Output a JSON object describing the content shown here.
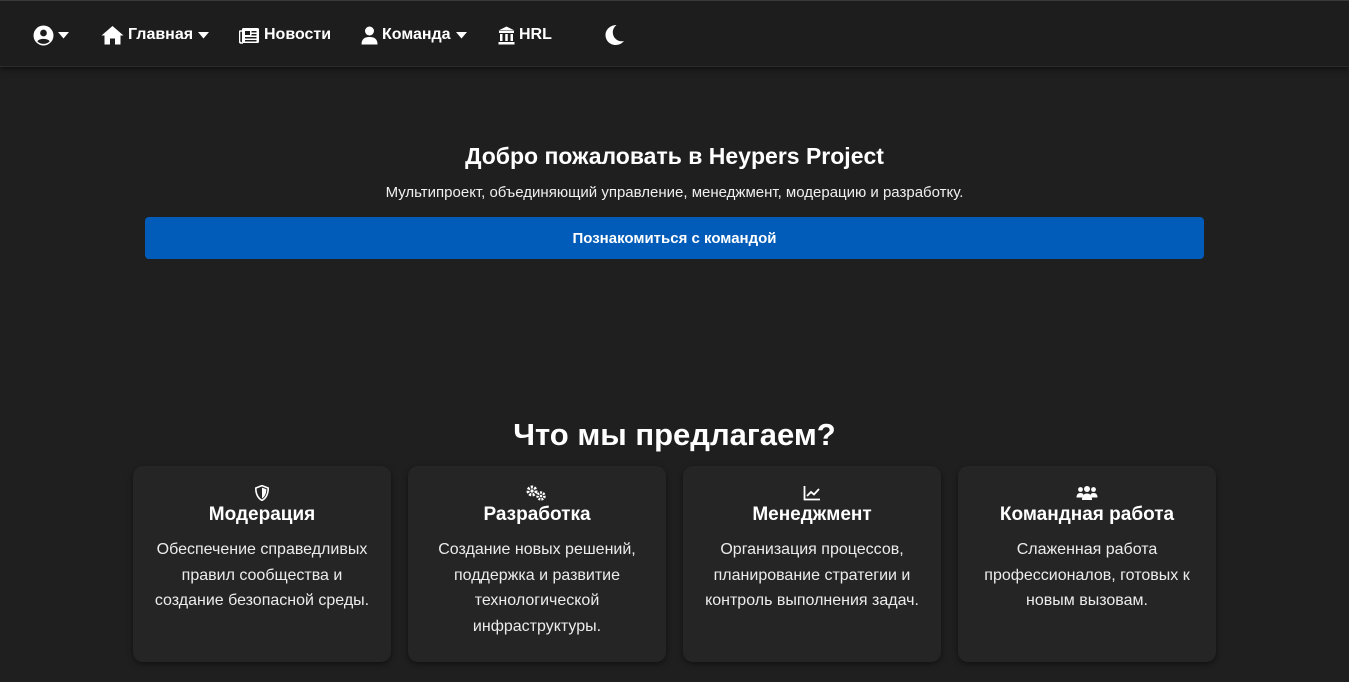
{
  "nav": {
    "user_icon": "user-circle-icon",
    "home_label": "Главная",
    "news_label": "Новости",
    "team_label": "Команда",
    "hrl_label": "HRL",
    "theme_icon": "moon-icon"
  },
  "hero": {
    "title": "Добро пожаловать в Heypers Project",
    "subtitle": "Мультипроект, объединяющий управление, менеджмент, модерацию и разработку.",
    "cta_label": "Познакомиться с командой"
  },
  "offer": {
    "title": "Что мы предлагаем?",
    "cards": [
      {
        "icon": "shield-icon",
        "title": "Модерация",
        "description": "Обеспечение справедливых правил сообщества и создание безопасной среды."
      },
      {
        "icon": "gears-icon",
        "title": "Разработка",
        "description": "Создание новых решений, поддержка и развитие технологической инфраструктуры."
      },
      {
        "icon": "chart-line-icon",
        "title": "Менеджмент",
        "description": "Организация процессов, планирование стратегии и контроль выполнения задач."
      },
      {
        "icon": "users-icon",
        "title": "Командная работа",
        "description": "Слаженная работа профессионалов, готовых к новым вызовам."
      }
    ]
  },
  "colors": {
    "background": "#1f1f1f",
    "navbar": "#1d1d1d",
    "card": "#252525",
    "accent": "#005cb8",
    "text": "#ffffff"
  }
}
